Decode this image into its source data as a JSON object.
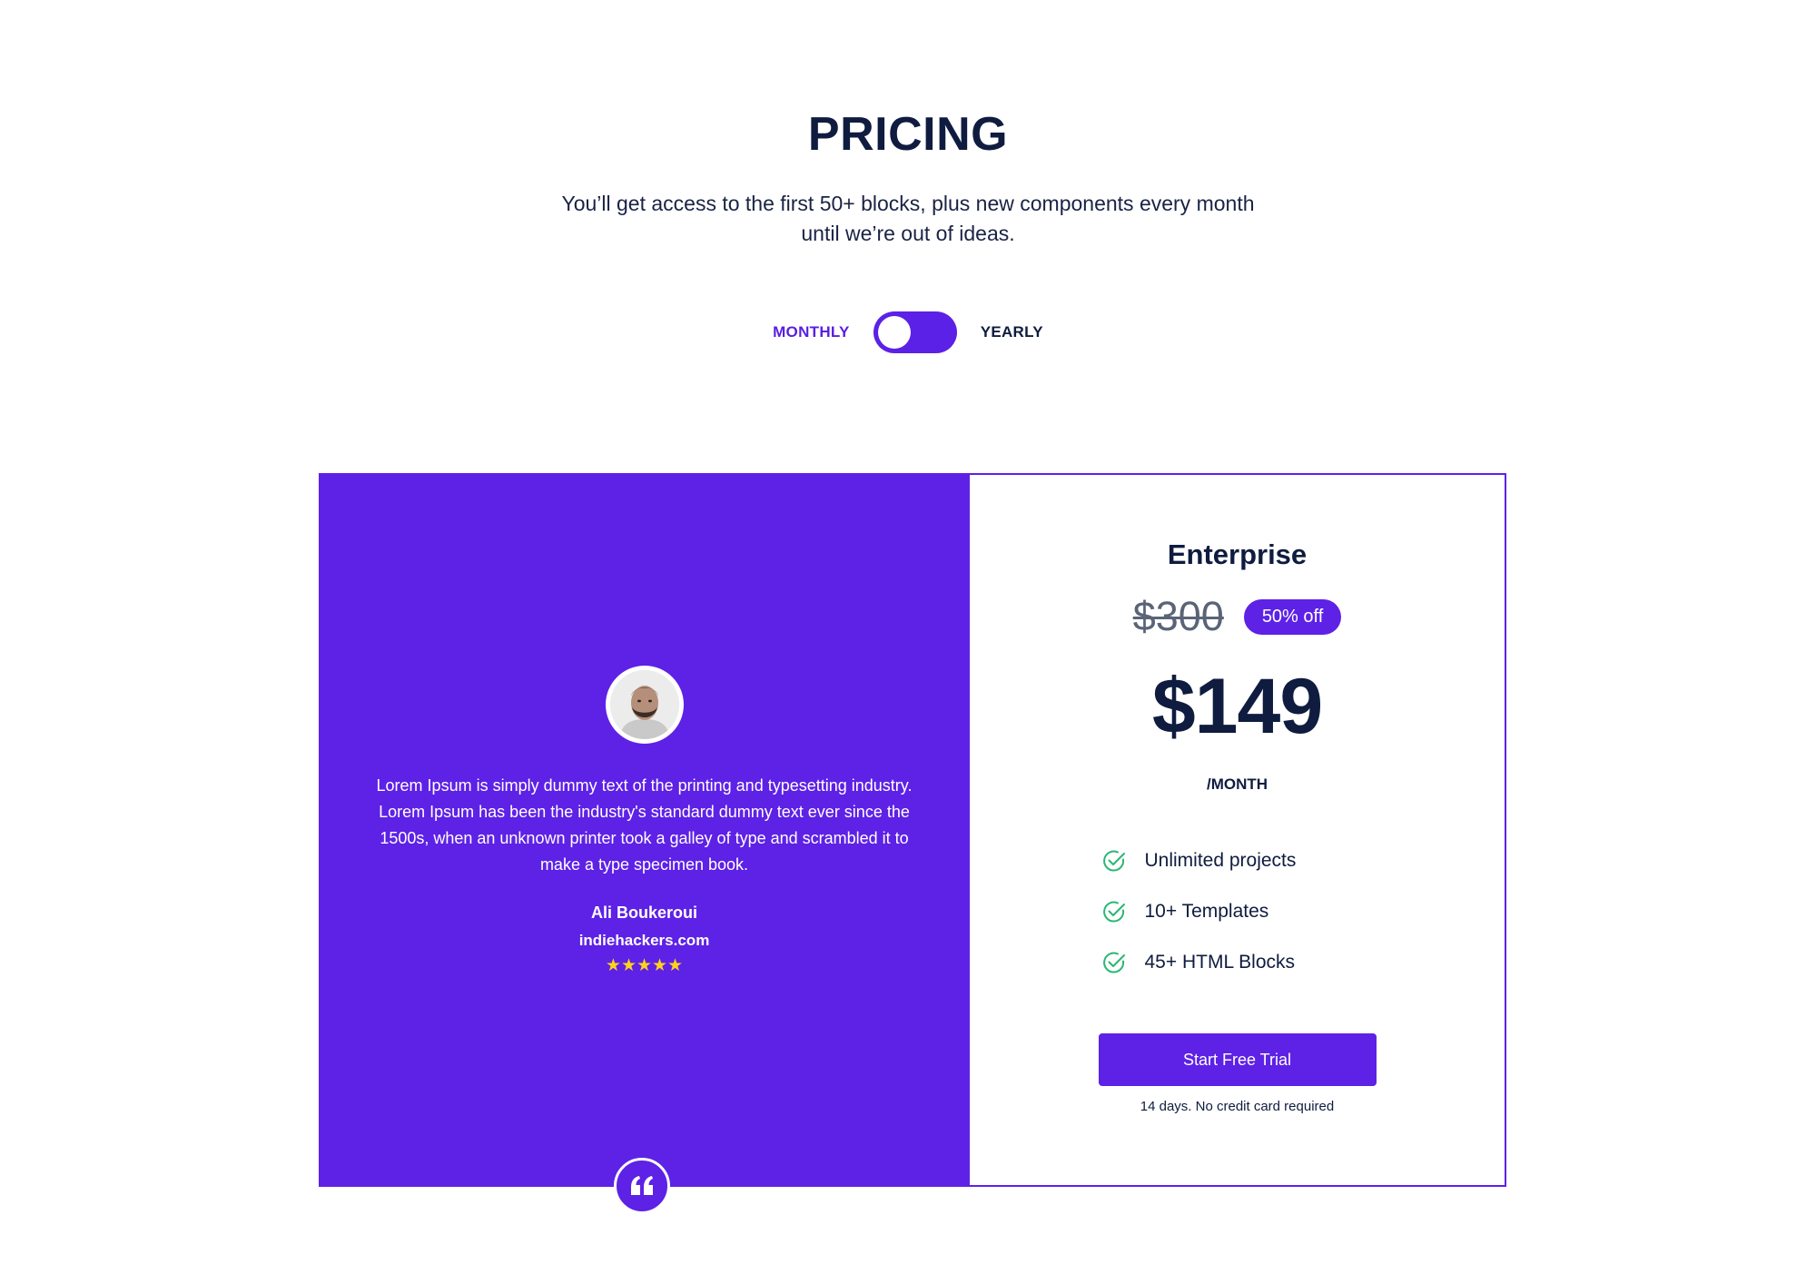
{
  "header": {
    "title": "PRICING",
    "subtitle": "You’ll get access to the first 50+ blocks, plus new components every month until we’re out of ideas."
  },
  "billing_toggle": {
    "monthly_label": "MONTHLY",
    "yearly_label": "YEARLY",
    "selected": "MONTHLY"
  },
  "testimonial": {
    "text": "Lorem Ipsum is simply dummy text of the printing and typesetting industry. Lorem Ipsum has been the industry's standard dummy text ever since the 1500s, when an unknown printer took a galley of type and scrambled it to make a type specimen book.",
    "author": "Ali Boukeroui",
    "site": "indiehackers.com",
    "rating": 5,
    "stars": "★★★★★"
  },
  "plan": {
    "name": "Enterprise",
    "old_price": "$300",
    "discount": "50% off",
    "price": "$149",
    "period": "/MONTH",
    "features": [
      "Unlimited projects",
      "10+ Templates",
      "45+ HTML Blocks"
    ],
    "cta_label": "Start Free Trial",
    "cta_note": "14 days. No credit card required"
  },
  "colors": {
    "brand": "#5e21e6",
    "heading": "#0f1c3f",
    "star": "#ffd21e",
    "check": "#2bb673"
  },
  "icons": {
    "feature": "check-circle-icon",
    "quote": "quote-icon",
    "star": "star-icon"
  }
}
